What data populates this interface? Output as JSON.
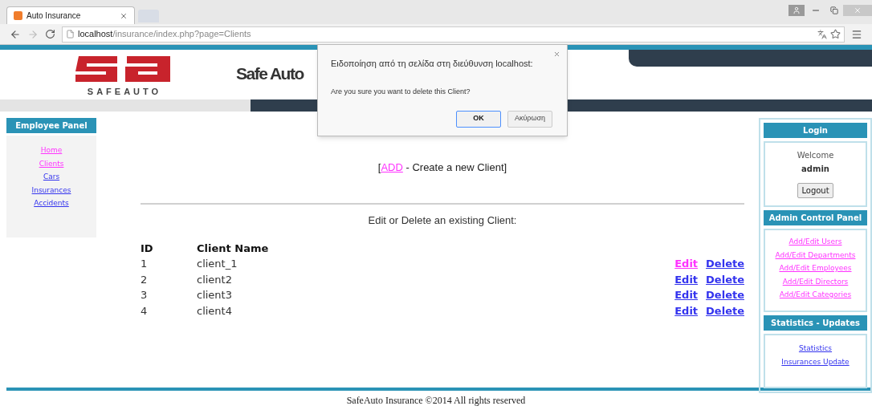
{
  "browser": {
    "tab_title": "Auto Insurance",
    "url_host": "localhost",
    "url_path": "/insurance/index.php?page=Clients"
  },
  "header": {
    "logo_text": "SAFEAUTO",
    "title": "Safe Auto"
  },
  "employee_panel": {
    "title": "Employee Panel",
    "links": [
      {
        "label": "Home",
        "visited": true
      },
      {
        "label": "Clients",
        "visited": true
      },
      {
        "label": "Cars",
        "visited": false
      },
      {
        "label": "Insurances",
        "visited": false
      },
      {
        "label": "Accidents",
        "visited": false
      }
    ]
  },
  "content": {
    "add_line": {
      "open": "[",
      "link": "ADD",
      "text": " - Create a new Client",
      "close": "]",
      "visited": true
    },
    "subtitle": "Edit or Delete an existing Client:",
    "table": {
      "columns": [
        "ID",
        "Client Name"
      ],
      "rows": [
        {
          "id": "1",
          "name": "client_1",
          "actions": [
            {
              "label": "Edit",
              "visited": true
            },
            {
              "label": "Delete",
              "visited": false
            }
          ]
        },
        {
          "id": "2",
          "name": "client2",
          "actions": [
            {
              "label": "Edit",
              "visited": false
            },
            {
              "label": "Delete",
              "visited": false
            }
          ]
        },
        {
          "id": "3",
          "name": "client3",
          "actions": [
            {
              "label": "Edit",
              "visited": false
            },
            {
              "label": "Delete",
              "visited": false
            }
          ]
        },
        {
          "id": "4",
          "name": "client4",
          "actions": [
            {
              "label": "Edit",
              "visited": false
            },
            {
              "label": "Delete",
              "visited": false
            }
          ]
        }
      ]
    }
  },
  "login": {
    "title": "Login",
    "welcome": "Welcome",
    "user": "admin",
    "button": "Logout"
  },
  "admin_panel": {
    "title": "Admin Control Panel",
    "links": [
      {
        "label": "Add/Edit Users",
        "visited": true
      },
      {
        "label": "Add/Edit Departments",
        "visited": true
      },
      {
        "label": "Add/Edit Employees",
        "visited": true
      },
      {
        "label": "Add/Edit Directors",
        "visited": true
      },
      {
        "label": "Add/Edit Categories",
        "visited": true
      }
    ]
  },
  "stats_panel": {
    "title": "Statistics - Updates",
    "links": [
      {
        "label": "Statistics",
        "visited": false
      },
      {
        "label": "Insurances Update",
        "visited": false
      }
    ]
  },
  "footer": "SafeAuto Insurance ©2014 All rights reserved",
  "dialog": {
    "title": "Ειδοποίηση από τη σελίδα στη διεύθυνση localhost:",
    "message": "Are you sure you want to delete this Client?",
    "buttons": [
      {
        "label": "OK",
        "default": true
      },
      {
        "label": "Ακύρωση",
        "default": false
      }
    ]
  }
}
